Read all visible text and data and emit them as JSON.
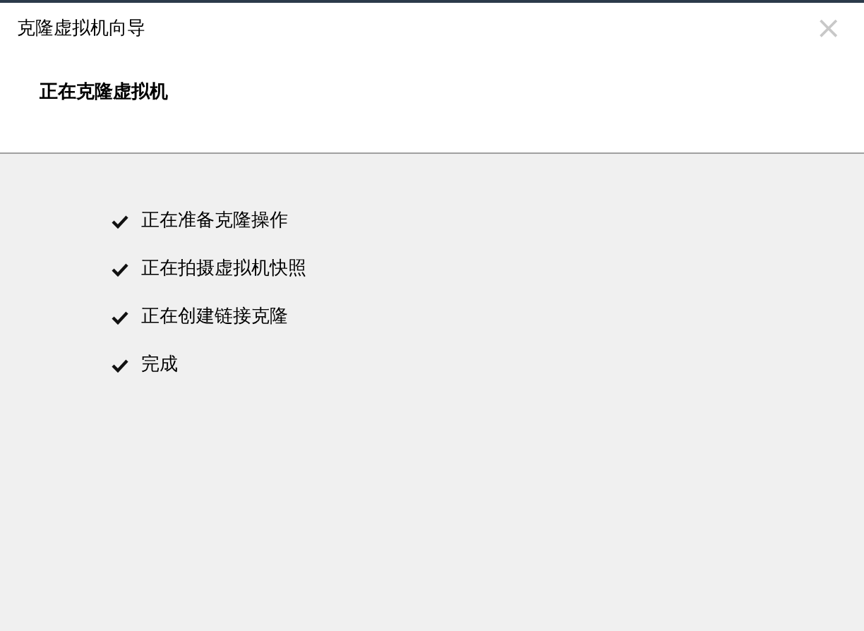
{
  "window": {
    "title": "克隆虚拟机向导",
    "close": "×"
  },
  "header": {
    "title": "正在克隆虚拟机"
  },
  "steps": [
    {
      "label": "正在准备克隆操作",
      "done": true
    },
    {
      "label": "正在拍摄虚拟机快照",
      "done": true
    },
    {
      "label": "正在创建链接克隆",
      "done": true
    },
    {
      "label": "完成",
      "done": true
    }
  ]
}
